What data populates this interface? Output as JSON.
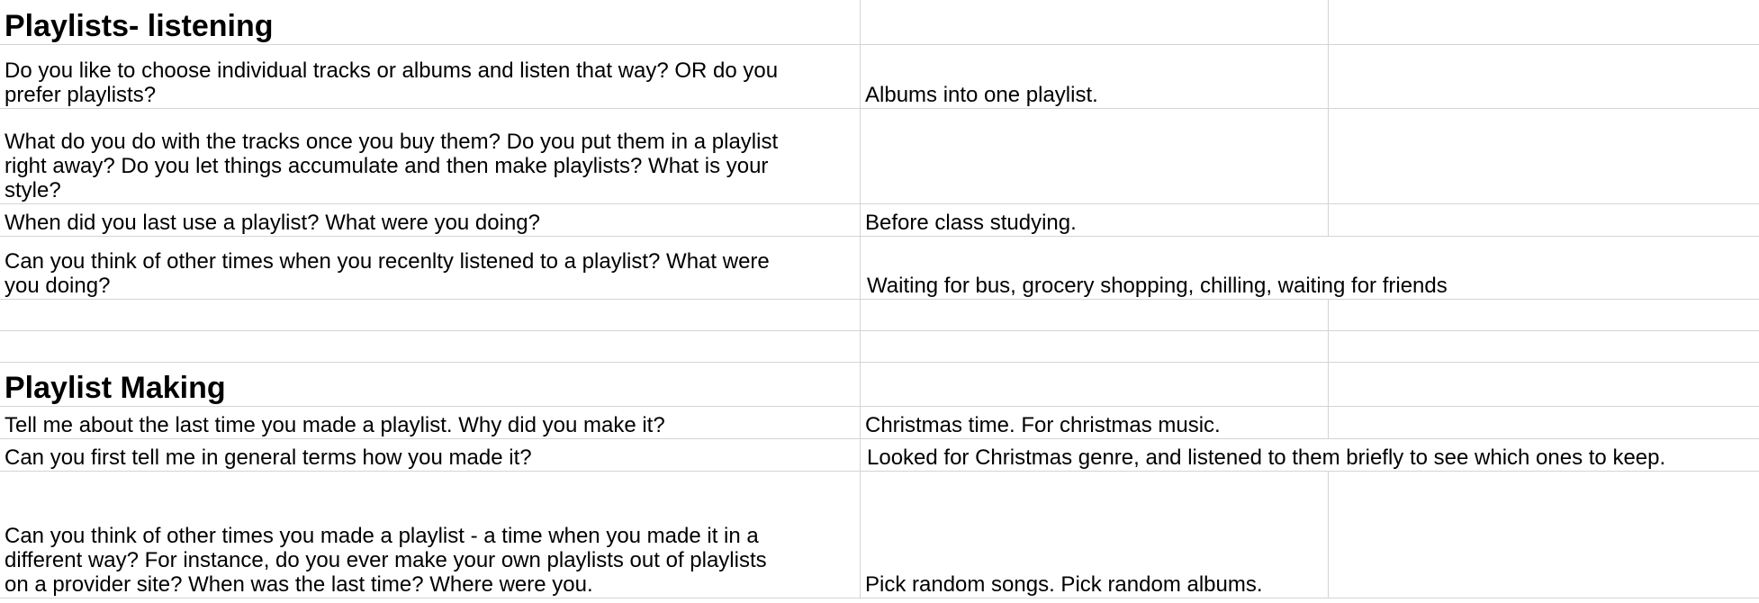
{
  "section_listening": {
    "title": "Playlists- listening",
    "rows": [
      {
        "question_lines": [
          "Do you like to choose individual tracks or albums and listen that way? OR do you",
          "prefer playlists?"
        ],
        "answer": "Albums into one playlist."
      },
      {
        "question_lines": [
          "What do you do with the tracks once you buy them?  Do you put them in a playlist",
          "right away?  Do you let things accumulate and then make playlists?  What is your",
          "style?"
        ],
        "answer": ""
      },
      {
        "question_lines": [
          "When did you last use a playlist?  What were you doing?"
        ],
        "answer": "Before class studying."
      },
      {
        "question_lines": [
          "Can you think of other times when you recenlty listened to a playlist?  What were",
          "you doing?"
        ],
        "answer": "Waiting for bus, grocery shopping, chilling, waiting for friends"
      }
    ]
  },
  "section_making": {
    "title": "Playlist Making",
    "rows": [
      {
        "question_lines": [
          "Tell me about the last time you made a playlist. Why did you make it?"
        ],
        "answer": "Christmas time. For christmas music."
      },
      {
        "question_lines": [
          "Can you first tell me in general terms how you made it?"
        ],
        "answer": "Looked for Christmas genre, and listened to them briefly to see which ones to keep."
      },
      {
        "question_lines": [
          "Can you think of other times you made a playlist - a time when you made it in a",
          "different way?  For instance, do you ever make your own playlists out of playlists",
          "on a provider site?  When was the last time?  Where were you."
        ],
        "answer": "Pick random songs. Pick random albums."
      }
    ]
  }
}
